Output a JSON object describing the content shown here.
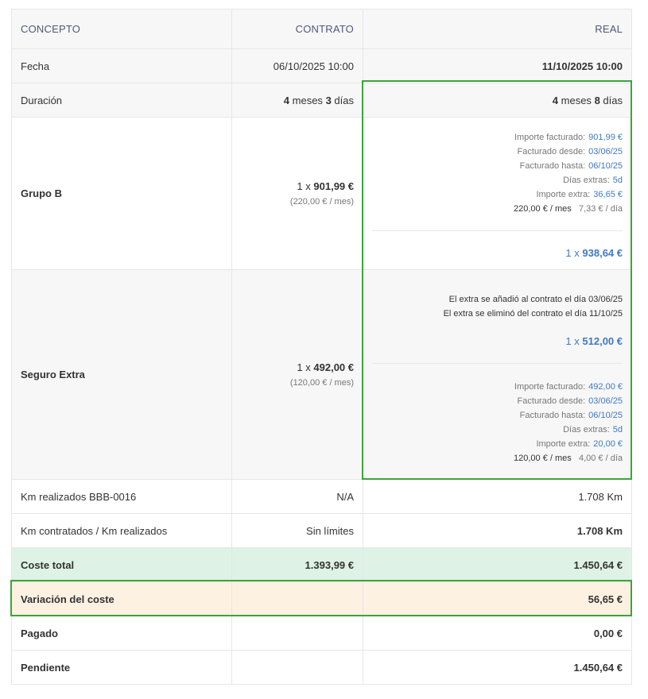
{
  "header": {
    "concepto": "CONCEPTO",
    "contrato": "CONTRATO",
    "real": "REAL"
  },
  "fecha": {
    "label": "Fecha",
    "contrato": "06/10/2025 10:00",
    "real": "11/10/2025 10:00"
  },
  "duracion": {
    "label": "Duración",
    "contrato": {
      "months": "4",
      "months_word": "meses",
      "days": "3",
      "days_word": "días"
    },
    "real": {
      "months": "4",
      "months_word": "meses",
      "days": "8",
      "days_word": "días"
    }
  },
  "grupo_b": {
    "label": "Grupo B",
    "contrato": {
      "qty": "1 x",
      "price": "901,99 €",
      "per_month": "(220,00 € / mes)"
    },
    "real": {
      "details": [
        {
          "label": "Importe facturado:",
          "value": "901,99 €"
        },
        {
          "label": "Facturado desde:",
          "value": "03/06/25"
        },
        {
          "label": "Facturado hasta:",
          "value": "06/10/25"
        },
        {
          "label": "Días extras:",
          "value": "5d"
        },
        {
          "label": "Importe extra:",
          "value": "36,65 €"
        }
      ],
      "rate_month": "220,00 € / mes",
      "rate_day": "7,33 € / día",
      "qty": "1 x",
      "total": "938,64 €"
    }
  },
  "seguro_extra": {
    "label": "Seguro Extra",
    "contrato": {
      "qty": "1 x",
      "price": "492,00 €",
      "per_month": "(120,00 € / mes)"
    },
    "real": {
      "note_added": "El extra se añadió al contrato el día 03/06/25",
      "note_removed": "El extra se eliminó del contrato el día 11/10/25",
      "qty": "1 x",
      "total": "512,00 €",
      "details": [
        {
          "label": "Importe facturado:",
          "value": "492,00 €"
        },
        {
          "label": "Facturado desde:",
          "value": "03/06/25"
        },
        {
          "label": "Facturado hasta:",
          "value": "06/10/25"
        },
        {
          "label": "Días extras:",
          "value": "5d"
        },
        {
          "label": "Importe extra:",
          "value": "20,00 €"
        }
      ],
      "rate_month": "120,00 € / mes",
      "rate_day": "4,00 € / día"
    }
  },
  "km_realizados": {
    "label": "Km realizados BBB-0016",
    "contrato": "N/A",
    "real": "1.708 Km"
  },
  "km_contratados": {
    "label": "Km contratados / Km realizados",
    "contrato": "Sin límites",
    "real": "1.708 Km"
  },
  "coste_total": {
    "label": "Coste total",
    "contrato": "1.393,99 €",
    "real": "1.450,64 €"
  },
  "variacion": {
    "label": "Variación del coste",
    "contrato": "",
    "real": "56,65 €"
  },
  "pagado": {
    "label": "Pagado",
    "contrato": "",
    "real": "0,00 €"
  },
  "pendiente": {
    "label": "Pendiente",
    "contrato": "",
    "real": "1.450,64 €"
  }
}
